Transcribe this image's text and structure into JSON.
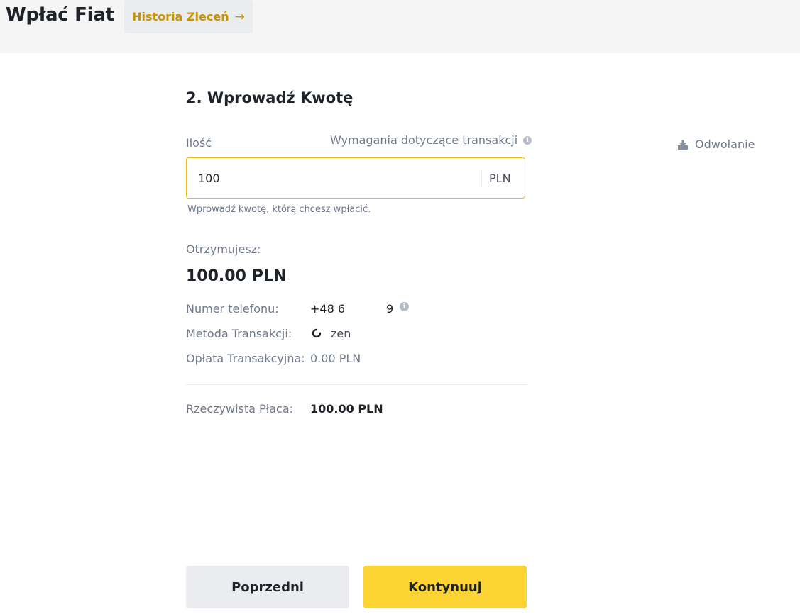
{
  "header": {
    "title": "Wpłać Fiat",
    "history_button": "Historia Zleceń",
    "history_arrow": "→"
  },
  "step": {
    "title": "2. Wprowadź Kwotę"
  },
  "amount": {
    "label": "Ilość",
    "requirements_link": "Wymagania dotyczące transakcji",
    "value": "100",
    "currency": "PLN",
    "hint": "Wprowadź kwotę, którą chcesz wpłacić."
  },
  "refund": {
    "label": "Odwołanie"
  },
  "summary": {
    "receive_label": "Otrzymujesz:",
    "receive_amount": "100.00",
    "receive_currency": "PLN",
    "phone_label": "Numer telefonu:",
    "phone_value_start": "+48 6",
    "phone_value_end": "9",
    "method_label": "Metoda Transakcji:",
    "method_value": "zen",
    "fee_label": "Opłata Transakcyjna:",
    "fee_value": "0.00 PLN",
    "real_label": "Rzeczywista Płaca:",
    "real_value": "100.00 PLN"
  },
  "buttons": {
    "previous": "Poprzedni",
    "continue": "Kontynuuj"
  },
  "colors": {
    "accent": "#fcd535",
    "link": "#c99400",
    "input_border": "#f0b90b",
    "secondary_button": "#eaecef"
  },
  "icons": {
    "requirements_info": "info-icon",
    "refund": "download-tray-icon",
    "phone_info": "info-icon",
    "method": "zen-logo-icon"
  }
}
